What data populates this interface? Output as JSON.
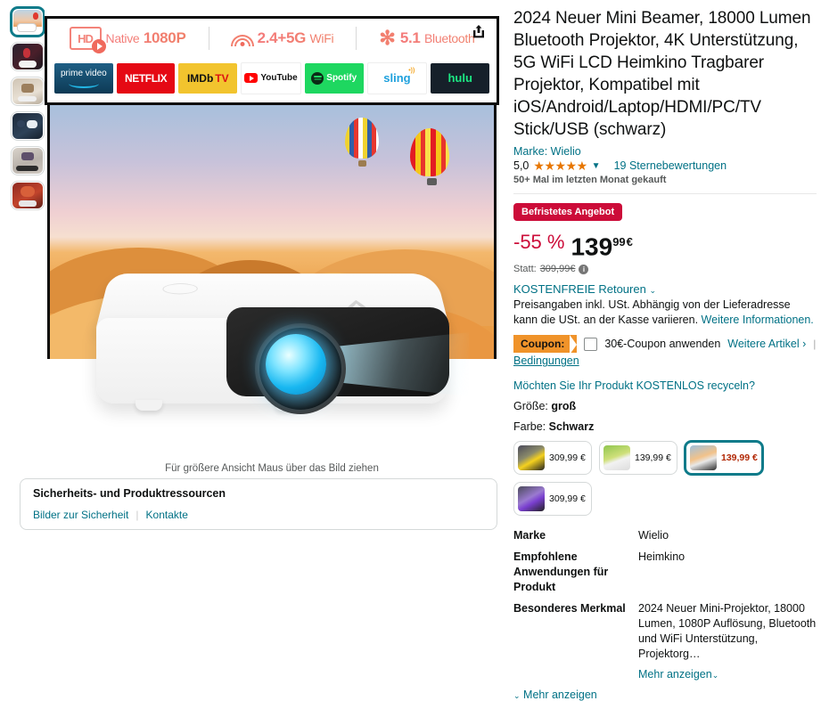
{
  "product": {
    "title": "2024 Neuer Mini Beamer, 18000 Lumen Bluetooth Projektor, 4K Unterstützung, 5G WiFi LCD Heimkino Tragbarer Projektor, Kompatibel mit iOS/Android/Laptop/HDMI/PC/TV Stick/USB (schwarz)",
    "brand_link": "Marke: Wielio",
    "rating_value": "5,0",
    "stars": "★★★★★",
    "rating_count": "19 Sternebewertungen",
    "bought_note": "50+ Mal im letzten Monat gekauft"
  },
  "price": {
    "deal_badge": "Befristetes Angebot",
    "discount": "-55 %",
    "amount_whole": "139",
    "amount_cents": "99",
    "currency": "€",
    "was_label": "Statt:",
    "was_price": "309,99€",
    "returns": "KOSTENFREIE Retouren",
    "tax_note": "Preisangaben inkl. USt. Abhängig von der Lieferadresse kann die USt. an der Kasse variieren.",
    "tax_link": "Weitere Informationen."
  },
  "coupon": {
    "tag": "Coupon:",
    "label": "30€-Coupon anwenden",
    "more_items": "Weitere Artikel",
    "terms": "Bedingungen",
    "checked": false
  },
  "recycle_link": "Möchten Sie Ihr Produkt KOSTENLOS recyceln?",
  "attributes": [
    {
      "key": "Größe:",
      "value": "groß"
    },
    {
      "key": "Farbe:",
      "value": "Schwarz"
    }
  ],
  "variants": [
    {
      "price": "309,99 €",
      "selected": false
    },
    {
      "price": "139,99 €",
      "selected": false
    },
    {
      "price": "139,99 €",
      "selected": true
    },
    {
      "price": "309,99 €",
      "selected": false
    }
  ],
  "specs": [
    {
      "key": "Marke",
      "value": "Wielio"
    },
    {
      "key": "Empfohlene Anwendungen für Produkt",
      "value": "Heimkino"
    },
    {
      "key": "Besonderes Merkmal",
      "value": "2024 Neuer Mini-Projektor, 18000 Lumen, 1080P Auflösung, Bluetooth und WiFi Unterstützung, Projektorg…"
    }
  ],
  "spec_more": "Mehr anzeigen",
  "page_more": "Mehr anzeigen",
  "gallery": {
    "hover_note": "Für größere Ansicht Maus über das Bild ziehen",
    "thumbnails": [
      {
        "alt": "desert-balloons-projector",
        "selected": true
      },
      {
        "alt": "spiderman-scene-projector",
        "selected": false
      },
      {
        "alt": "mario-living-room-projector",
        "selected": false
      },
      {
        "alt": "accessories-flatlay",
        "selected": false
      },
      {
        "alt": "anime-wall-projection",
        "selected": false
      },
      {
        "alt": "outdoor-movie-night",
        "selected": false
      }
    ],
    "share_icon": "share-icon"
  },
  "banner": {
    "features": [
      {
        "icon": "hd-play-icon",
        "text_light": "Native",
        "text_bold": "1080P"
      },
      {
        "icon": "wifi-icon",
        "text_bold": "2.4+5G",
        "text_light": "WiFi"
      },
      {
        "icon": "bluetooth-icon",
        "text_bold": "5.1",
        "text_light": "Bluetooth"
      }
    ],
    "logos": [
      {
        "name": "prime video"
      },
      {
        "name": "NETFLIX"
      },
      {
        "name": "IMDb"
      },
      {
        "name": "YouTube"
      },
      {
        "name": "Spotify"
      },
      {
        "name": "sling"
      },
      {
        "name": "hulu"
      }
    ]
  },
  "safety": {
    "title": "Sicherheits- und Produktressourcen",
    "links": [
      "Bilder zur Sicherheit",
      "Kontakte"
    ]
  },
  "colors": {
    "link": "#007185",
    "deal_red": "#cc0c39",
    "price_red": "#b12704",
    "coupon_orange": "#f0932a",
    "selected_border": "#0f7b8a",
    "star_orange": "#e77600"
  }
}
